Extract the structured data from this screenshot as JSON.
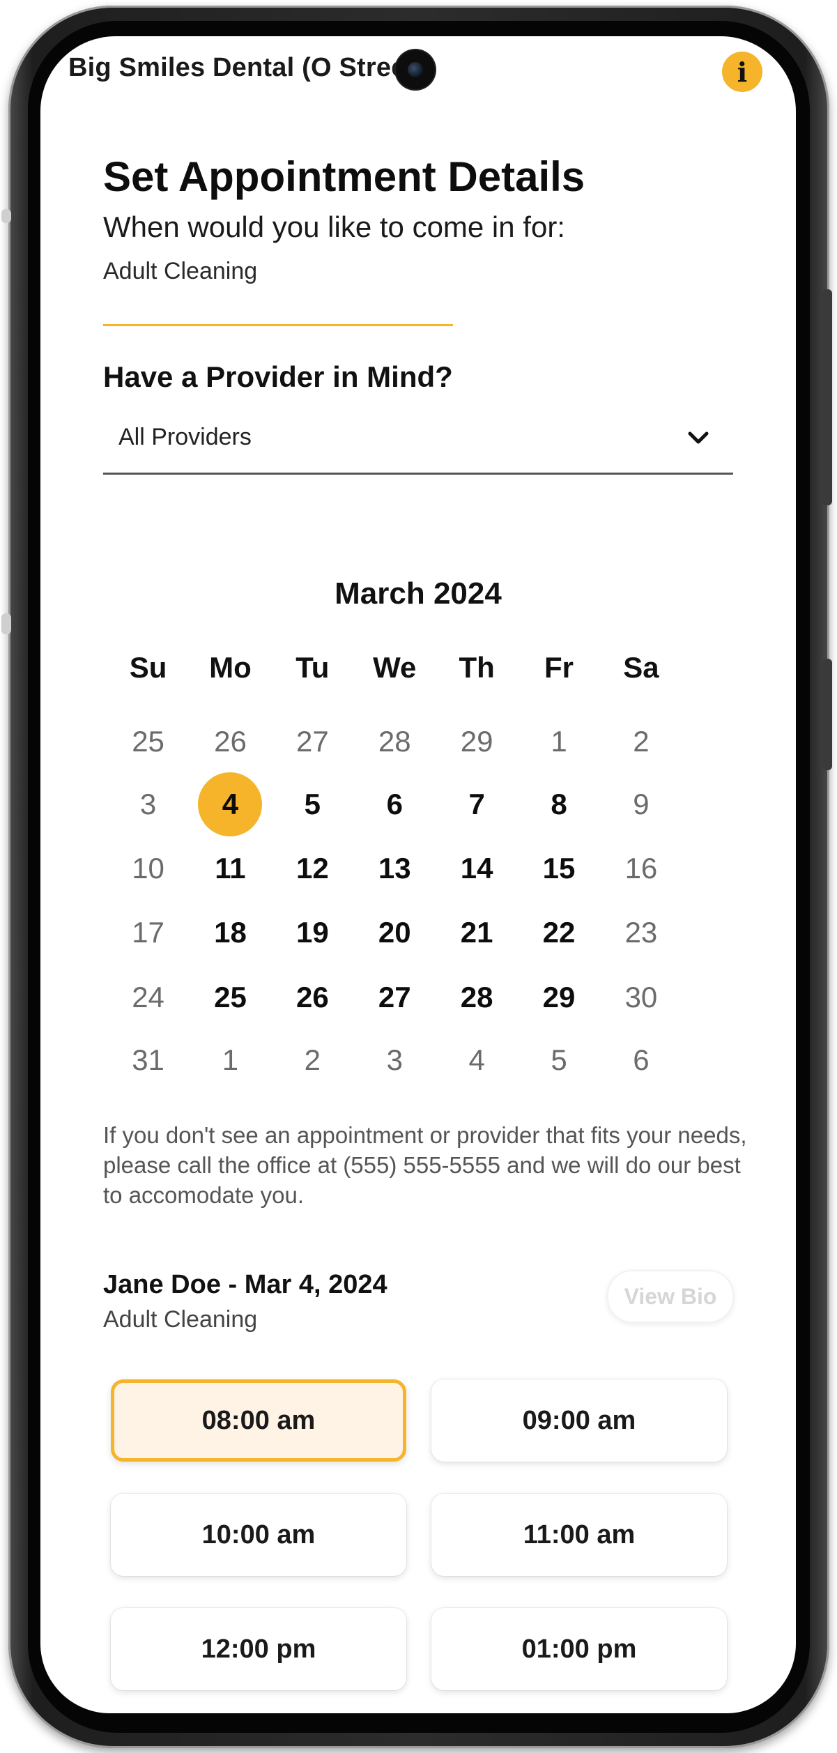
{
  "header": {
    "practice_name": "Big Smiles Dental (O Street)",
    "info_label": "i"
  },
  "page": {
    "title": "Set Appointment Details",
    "subtitle": "When would you like to come in for:",
    "service": "Adult Cleaning"
  },
  "provider": {
    "heading": "Have a Provider in Mind?",
    "selected": "All Providers"
  },
  "calendar": {
    "month": "March 2024",
    "weekdays": [
      "Su",
      "Mo",
      "Tu",
      "We",
      "Th",
      "Fr",
      "Sa"
    ],
    "weeks": [
      [
        {
          "d": "25",
          "s": "muted"
        },
        {
          "d": "26",
          "s": "muted"
        },
        {
          "d": "27",
          "s": "muted"
        },
        {
          "d": "28",
          "s": "muted"
        },
        {
          "d": "29",
          "s": "muted"
        },
        {
          "d": "1",
          "s": "muted"
        },
        {
          "d": "2",
          "s": "muted"
        }
      ],
      [
        {
          "d": "3",
          "s": "muted"
        },
        {
          "d": "4",
          "s": "selected"
        },
        {
          "d": "5",
          "s": "available"
        },
        {
          "d": "6",
          "s": "available"
        },
        {
          "d": "7",
          "s": "available"
        },
        {
          "d": "8",
          "s": "available"
        },
        {
          "d": "9",
          "s": "muted"
        }
      ],
      [
        {
          "d": "10",
          "s": "muted"
        },
        {
          "d": "11",
          "s": "available"
        },
        {
          "d": "12",
          "s": "available"
        },
        {
          "d": "13",
          "s": "available"
        },
        {
          "d": "14",
          "s": "available"
        },
        {
          "d": "15",
          "s": "available"
        },
        {
          "d": "16",
          "s": "muted"
        }
      ],
      [
        {
          "d": "17",
          "s": "muted"
        },
        {
          "d": "18",
          "s": "available"
        },
        {
          "d": "19",
          "s": "available"
        },
        {
          "d": "20",
          "s": "available"
        },
        {
          "d": "21",
          "s": "available"
        },
        {
          "d": "22",
          "s": "available"
        },
        {
          "d": "23",
          "s": "muted"
        }
      ],
      [
        {
          "d": "24",
          "s": "muted"
        },
        {
          "d": "25",
          "s": "available"
        },
        {
          "d": "26",
          "s": "available"
        },
        {
          "d": "27",
          "s": "available"
        },
        {
          "d": "28",
          "s": "available"
        },
        {
          "d": "29",
          "s": "available"
        },
        {
          "d": "30",
          "s": "muted"
        }
      ],
      [
        {
          "d": "31",
          "s": "muted"
        },
        {
          "d": "1",
          "s": "muted"
        },
        {
          "d": "2",
          "s": "muted"
        },
        {
          "d": "3",
          "s": "muted"
        },
        {
          "d": "4",
          "s": "muted"
        },
        {
          "d": "5",
          "s": "muted"
        },
        {
          "d": "6",
          "s": "muted"
        }
      ]
    ]
  },
  "notice": "If you don't see an appointment or provider that fits your needs, please call the office at (555) 555-5555 and we will do our best to accomodate you.",
  "slots_section": {
    "provider_date": "Jane Doe - Mar 4, 2024",
    "service": "Adult Cleaning",
    "view_bio_label": "View Bio",
    "times": [
      "08:00 am",
      "09:00 am",
      "10:00 am",
      "11:00 am",
      "12:00 pm",
      "01:00 pm"
    ],
    "selected_time": "08:00 am"
  },
  "colors": {
    "accent": "#f5b42a",
    "selected_slot_bg": "#fff3e6"
  }
}
